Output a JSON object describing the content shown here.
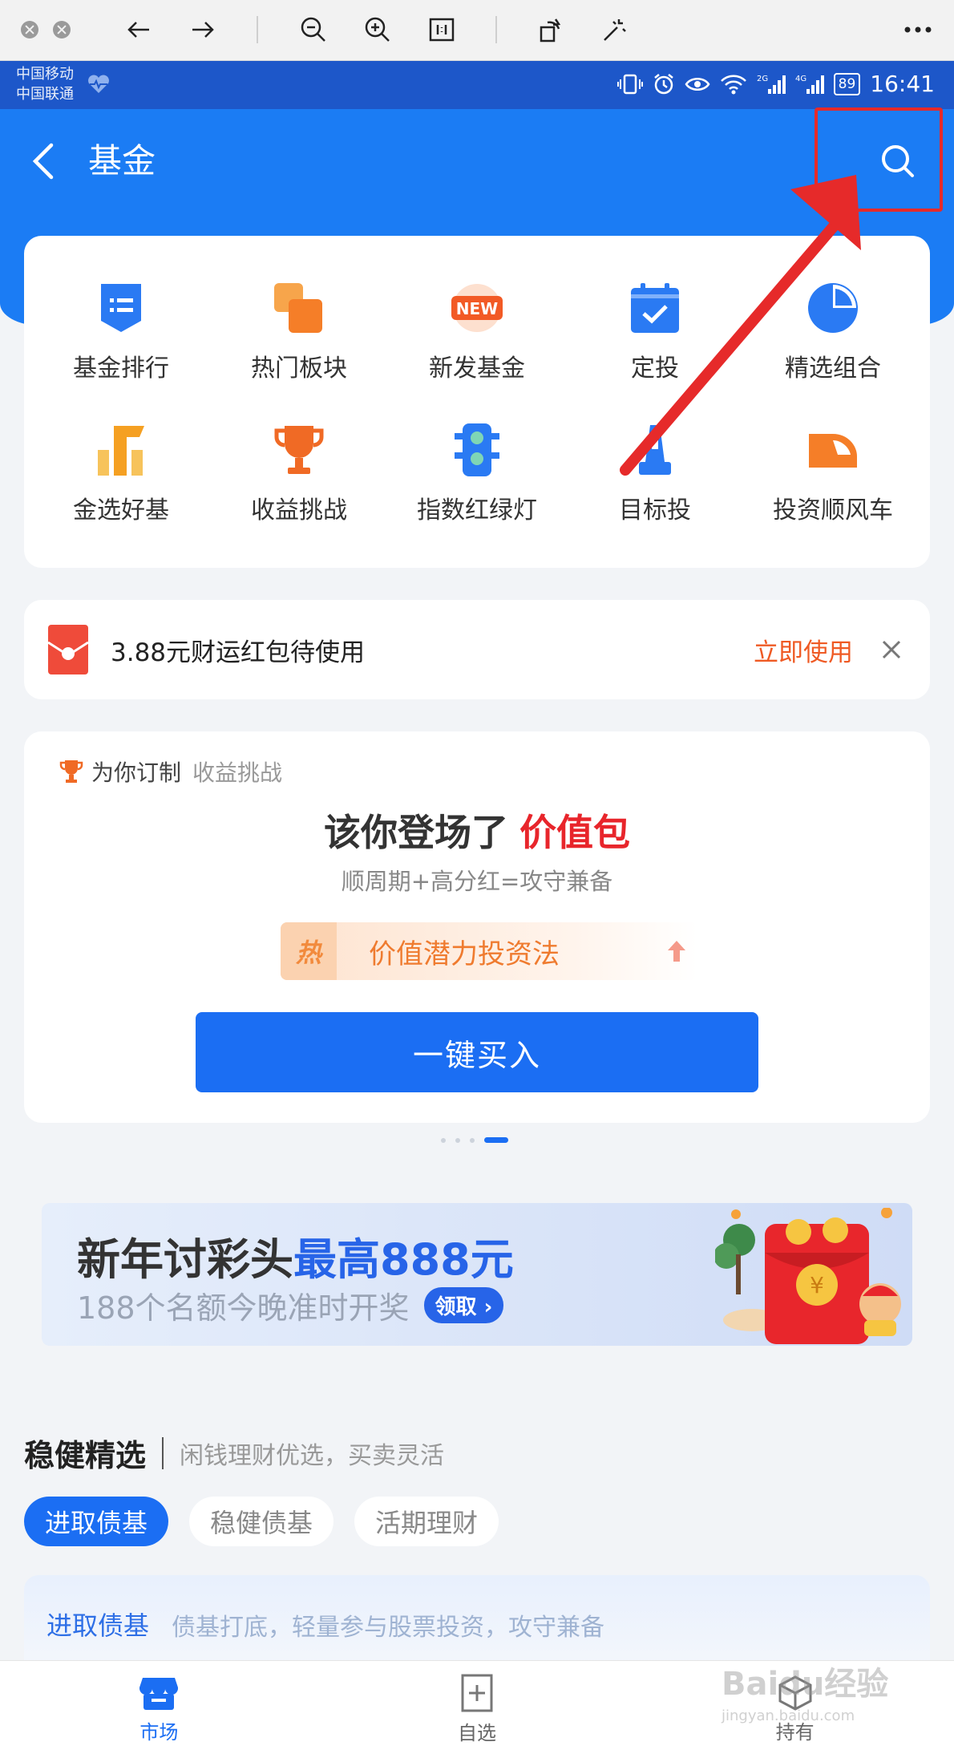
{
  "status_bar": {
    "carrier1": "中国移动",
    "carrier2": "中国联通",
    "battery": "89",
    "time": "16:41"
  },
  "header": {
    "title": "基金"
  },
  "grid": [
    {
      "label": "基金排行",
      "icon": "ranking-list-icon",
      "color": "#2a7af3"
    },
    {
      "label": "热门板块",
      "icon": "hot-sectors-icon",
      "color": "#f57e28"
    },
    {
      "label": "新发基金",
      "icon": "new-badge-icon",
      "color": "#f25a25"
    },
    {
      "label": "定投",
      "icon": "calendar-check-icon",
      "color": "#2a7af3"
    },
    {
      "label": "精选组合",
      "icon": "pie-chart-icon",
      "color": "#2a7af3"
    },
    {
      "label": "金选好基",
      "icon": "gold-fund-icon",
      "color": "#f5a022"
    },
    {
      "label": "收益挑战",
      "icon": "trophy-icon",
      "color": "#f06a25"
    },
    {
      "label": "指数红绿灯",
      "icon": "traffic-light-icon",
      "color": "#2a7af3"
    },
    {
      "label": "目标投",
      "icon": "target-tower-icon",
      "color": "#2a7af3"
    },
    {
      "label": "投资顺风车",
      "icon": "bullet-train-icon",
      "color": "#f57e28"
    }
  ],
  "promo": {
    "text": "3.88元财运红包待使用",
    "action": "立即使用"
  },
  "feature": {
    "tag": "为你订制",
    "subtag": "收益挑战",
    "title_main": "该你登场了",
    "title_highlight": "价值包",
    "desc": "顺周期+高分红=攻守兼备",
    "hot_badge": "热",
    "hot_text": "价值潜力投资法",
    "buy_button": "一键买入"
  },
  "banner": {
    "title_dark": "新年讨彩头",
    "title_blue": "最高888元",
    "subtitle": "188个名额今晚准时开奖",
    "pill": "领取 ›"
  },
  "section": {
    "title": "稳健精选",
    "subtitle": "闲钱理财优选，买卖灵活",
    "chips": [
      "进取债基",
      "稳健债基",
      "活期理财"
    ],
    "card_title": "进取债基",
    "card_desc": "债基打底，轻量参与股票投资，攻守兼备"
  },
  "bottom_nav": [
    {
      "label": "市场",
      "icon": "market-store-icon",
      "active": true
    },
    {
      "label": "自选",
      "icon": "add-watchlist-icon",
      "active": false
    },
    {
      "label": "持有",
      "icon": "holdings-icon",
      "active": false
    }
  ],
  "watermark": {
    "text": "Baidu经验",
    "url": "jingyan.baidu.com"
  },
  "colors": {
    "brand": "#1b7cf4",
    "accent_orange": "#ef5a24",
    "highlight_red": "#e8252b",
    "annotation_red": "#e62a2a"
  }
}
